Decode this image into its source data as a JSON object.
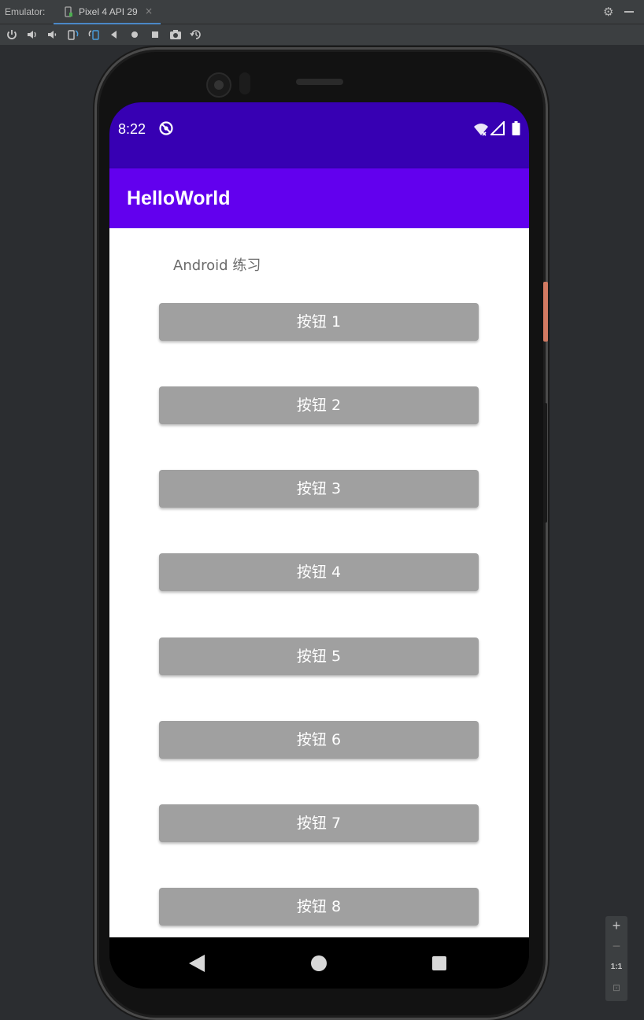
{
  "ide": {
    "label": "Emulator:",
    "tab_title": "Pixel 4 API 29",
    "tab_close": "×",
    "gear": "⚙"
  },
  "toolbar": {
    "buttons": [
      "power-icon",
      "volume-up-icon",
      "volume-down-icon",
      "rotate-left-icon",
      "rotate-right-icon",
      "back-icon",
      "home-icon",
      "overview-icon",
      "screenshot-icon",
      "snapshot-icon"
    ]
  },
  "device": {
    "status": {
      "time": "8:22"
    },
    "app": {
      "title": "HelloWorld",
      "intro": "Android 练习",
      "buttons": [
        "按钮 1",
        "按钮 2",
        "按钮 3",
        "按钮 4",
        "按钮 5",
        "按钮 6",
        "按钮 7",
        "按钮 8"
      ]
    }
  },
  "zoom": {
    "in": "+",
    "out": "−",
    "actual": "1:1",
    "fit": "⊡"
  },
  "colors": {
    "status_bar": "#3700b3",
    "app_bar": "#6200ee",
    "button": "#a0a0a0",
    "ide_bg": "#2b2d30"
  }
}
